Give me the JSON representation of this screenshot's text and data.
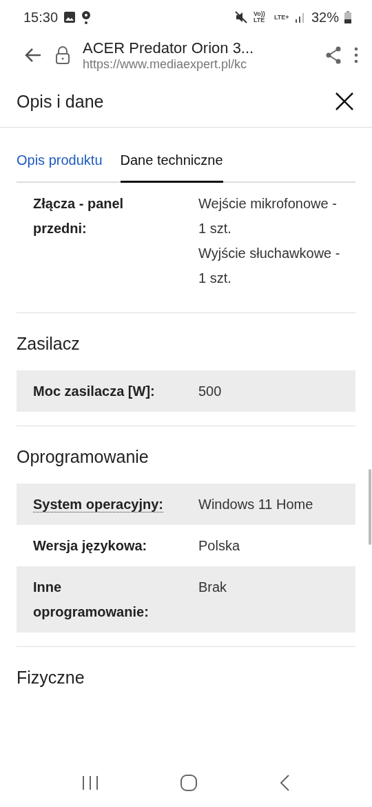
{
  "status_bar": {
    "time": "15:30",
    "volte": "Vo)) LTE",
    "network": "LTE+",
    "battery": "32%"
  },
  "browser": {
    "title": "ACER Predator Orion 3...",
    "url": "https://www.mediaexpert.pl/kc"
  },
  "sheet": {
    "title": "Opis i dane"
  },
  "tabs": [
    {
      "label": "Opis produktu",
      "selected": false
    },
    {
      "label": "Dane techniczne",
      "selected": true
    }
  ],
  "sections": [
    {
      "rows": [
        {
          "label": "Złącza - panel przedni:",
          "values": [
            "Wejście mikrofonowe - 1 szt.",
            "Wyjście słuchawkowe - 1 szt."
          ],
          "shaded": false,
          "dotted_underline": false
        }
      ]
    },
    {
      "title": "Zasilacz",
      "rows": [
        {
          "label": "Moc zasilacza [W]:",
          "values": [
            "500"
          ],
          "shaded": true,
          "dotted_underline": false
        }
      ]
    },
    {
      "title": "Oprogramowanie",
      "rows": [
        {
          "label": "System operacyjny:",
          "values": [
            "Windows 11 Home"
          ],
          "shaded": true,
          "dotted_underline": true
        },
        {
          "label": "Wersja językowa:",
          "values": [
            "Polska"
          ],
          "shaded": false,
          "dotted_underline": false
        },
        {
          "label": "Inne oprogramowanie:",
          "values": [
            "Brak"
          ],
          "shaded": true,
          "dotted_underline": false
        }
      ]
    },
    {
      "title": "Fizyczne"
    }
  ]
}
